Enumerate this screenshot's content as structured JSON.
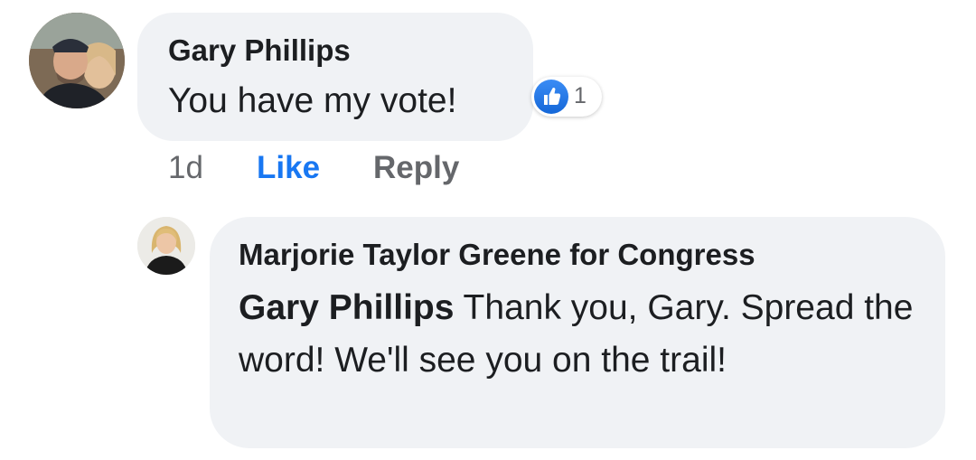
{
  "comment": {
    "author": "Gary Phillips",
    "text": "You have my vote!",
    "reaction_count": "1",
    "reaction_icon": "thumbs-up-icon",
    "timestamp": "1d",
    "like_label": "Like",
    "reply_label": "Reply"
  },
  "reply": {
    "author": "Marjorie Taylor Greene for Congress",
    "mention": "Gary Phillips",
    "text": " Thank you, Gary. Spread the word! We'll see you on the trail!"
  },
  "colors": {
    "link_blue": "#1877f2",
    "bubble_gray": "#f0f2f5",
    "secondary_text": "#65676b"
  }
}
